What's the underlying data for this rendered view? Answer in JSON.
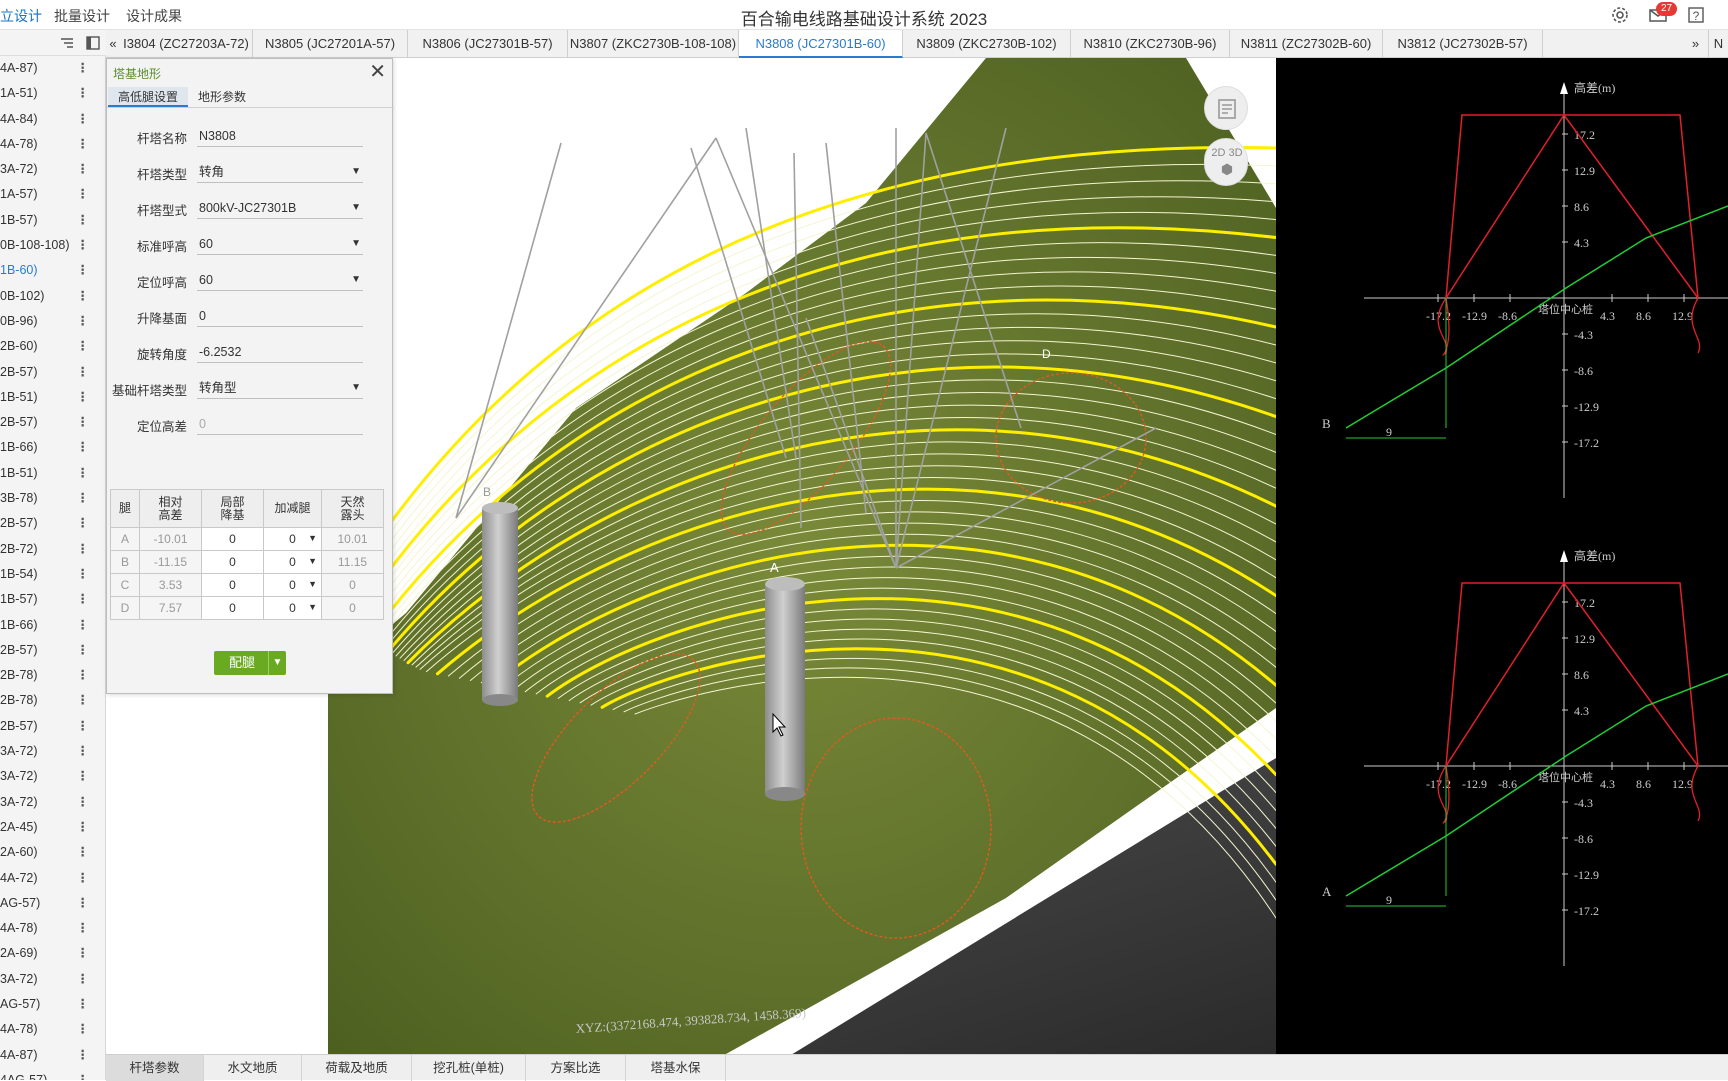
{
  "app": {
    "title": "百合输电线路基础设计系统 2023",
    "notif_count": "27"
  },
  "menu": [
    {
      "label": "立设计"
    },
    {
      "label": "批量设计"
    },
    {
      "label": "设计成果"
    }
  ],
  "left_list": {
    "items": [
      "4A-87)",
      "1A-51)",
      "4A-84)",
      "4A-78)",
      "3A-72)",
      "1A-57)",
      "1B-57)",
      "0B-108-108)",
      "1B-60)",
      "0B-102)",
      "0B-96)",
      "2B-60)",
      "2B-57)",
      "1B-51)",
      "2B-57)",
      "1B-66)",
      "1B-51)",
      "3B-78)",
      "2B-57)",
      "2B-72)",
      "1B-54)",
      "1B-57)",
      "1B-66)",
      "2B-57)",
      "2B-78)",
      "2B-78)",
      "2B-57)",
      "3A-72)",
      "3A-72)",
      "3A-72)",
      "2A-45)",
      "2A-60)",
      "4A-72)",
      "AG-57)",
      "4A-78)",
      "2A-69)",
      "3A-72)",
      "AG-57)",
      "4A-78)",
      "4A-87)",
      "4AG-57)"
    ],
    "active_index": 8
  },
  "tabs": [
    "I3804 (ZC27203A-72)",
    "N3805 (JC27201A-57)",
    "N3806 (JC27301B-57)",
    "N3807 (ZKC2730B-108-108)",
    "N3808 (JC27301B-60)",
    "N3809 (ZKC2730B-102)",
    "N3810 (ZKC2730B-96)",
    "N3811 (ZC27302B-60)",
    "N3812 (JC27302B-57)"
  ],
  "active_tab": 4,
  "tabs_more": "»",
  "tabs_prev": "«",
  "tabs_extra": "N",
  "panel": {
    "title": "塔基地形",
    "tabs": [
      "高低腿设置",
      "地形参数"
    ],
    "fields": [
      {
        "label": "杆塔名称",
        "value": "N3808",
        "dropdown": false
      },
      {
        "label": "杆塔类型",
        "value": "转角",
        "dropdown": true
      },
      {
        "label": "杆塔型式",
        "value": "800kV-JC27301B",
        "dropdown": true
      },
      {
        "label": "标准呼高",
        "value": "60",
        "dropdown": true
      },
      {
        "label": "定位呼高",
        "value": "60",
        "dropdown": true
      },
      {
        "label": "升降基面",
        "value": "0",
        "dropdown": false
      },
      {
        "label": "旋转角度",
        "value": "-6.2532",
        "dropdown": false
      },
      {
        "label": "基础杆塔类型",
        "value": "转角型",
        "dropdown": true
      },
      {
        "label": "定位高差",
        "value": "0",
        "dropdown": false,
        "disabled": true
      }
    ],
    "table": {
      "headers": [
        "腿",
        "相对高差",
        "局部降基",
        "加减腿",
        "天然露头"
      ],
      "rows": [
        {
          "leg": "A",
          "rel": "-10.01",
          "local": "0",
          "adj": "0",
          "nat": "10.01"
        },
        {
          "leg": "B",
          "rel": "-11.15",
          "local": "0",
          "adj": "0",
          "nat": "11.15"
        },
        {
          "leg": "C",
          "rel": "3.53",
          "local": "0",
          "adj": "0",
          "nat": "0"
        },
        {
          "leg": "D",
          "rel": "7.57",
          "local": "0",
          "adj": "0",
          "nat": "0"
        }
      ]
    },
    "config_button": "配腿"
  },
  "viewport": {
    "view_mode": "2D 3D",
    "coord_text": "XYZ:(3372168.474, 393828.734, 1458.369)",
    "leg_labels": [
      "B",
      "A",
      "D"
    ]
  },
  "cad": {
    "elev_label": "高差(m)",
    "y_ticks_top": [
      "17.2",
      "12.9",
      "8.6",
      "4.3",
      "-4.3",
      "-8.6",
      "-12.9",
      "-17.2"
    ],
    "x_ticks": [
      "-17.2",
      "-12.9",
      "-8.6",
      "4.3",
      "8.6",
      "12.9"
    ],
    "center_label": "塔位中心桩",
    "dim_label": "9",
    "leg_b": "B",
    "leg_a": "A"
  },
  "bottom_tabs": [
    "杆塔参数",
    "水文地质",
    "荷载及地质",
    "挖孔桩(单桩)",
    "方案比选",
    "塔基水保"
  ],
  "active_bottom_tab": 0,
  "colors": {
    "accent": "#2a7ad0",
    "green_btn": "#6aaa22",
    "contour_yellow": "#ffee00",
    "cad_red": "#e0202a",
    "cad_green": "#22cc33"
  }
}
